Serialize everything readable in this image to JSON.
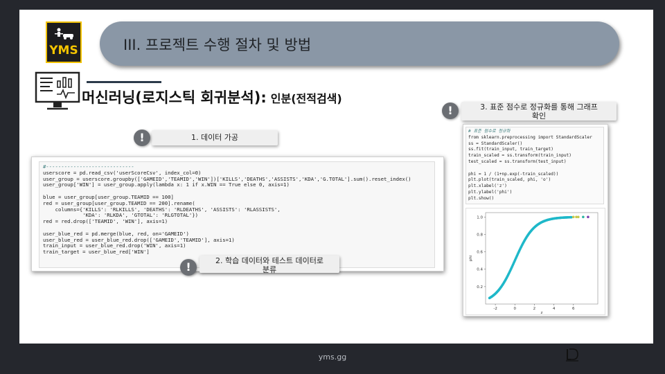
{
  "logo": {
    "text": "YMS"
  },
  "header": {
    "title": "III. 프로젝트 수행 절차 및 방법"
  },
  "headline": {
    "main": "머신러닝(로지스틱 회귀분석):",
    "sub": "인분(전적검색)"
  },
  "callouts": [
    {
      "label": "1. 데이터 가공"
    },
    {
      "label_line1": "2. 학습 데이터와 테스트 데이터로",
      "label_line2": "분류"
    },
    {
      "label_line1": "3. 표준 점수로 정규화를 통해 그래프",
      "label_line2": "확인"
    }
  ],
  "code_left": {
    "lines": [
      "#-----------------------------",
      "userscore = pd.read_csv('userScoreCsv', index_col=0)",
      "user_group = userscore.groupby(['GAMEID','TEAMID','WIN'])['KILLS','DEATHS','ASSISTS','KDA','G.TOTAL'].sum().reset_index()",
      "user_group['WIN'] = user_group.apply(lambda x: 1 if x.WIN == True else 0, axis=1)",
      "",
      "blue = user_group[user_group.TEAMID == 100]",
      "red = user_group[user_group.TEAMID == 200].rename(",
      "    columns={'KILLS': 'RLKILLS', 'DEATHS': 'RLDEATHS', 'ASSISTS': 'RLASSISTS',",
      "             'KDA': 'RLKDA', 'GTOTAL': 'RLGTOTAL'})",
      "red = red.drop(['TEAMID', 'WIN'], axis=1)",
      "",
      "user_blue_red = pd.merge(blue, red, on='GAMEID')",
      "user_blue_red = user_blue_red.drop(['GAMEID','TEAMID'], axis=1)",
      "train_input = user_blue_red.drop('WIN', axis=1)",
      "train_target = user_blue_red['WIN']"
    ]
  },
  "code_right": {
    "lines": [
      "# 표준 점수로 정규화",
      "from sklearn.preprocessing import StandardScaler",
      "ss = StandardScaler()",
      "ss.fit(train_input, train_target)",
      "train_scaled = ss.transform(train_input)",
      "test_scaled = ss.transform(test_input)",
      "",
      "phi = 1 / (1+np.exp(-train_scaled))",
      "plt.plot(train_scaled, phi, 'o')",
      "plt.xlabel('z')",
      "plt.ylabel('phi')",
      "plt.show()"
    ]
  },
  "chart_data": {
    "type": "scatter",
    "title": "",
    "xlabel": "z",
    "ylabel": "phi",
    "xlim": [
      -3,
      8.5
    ],
    "ylim": [
      0,
      1.05
    ],
    "xticks": [
      -2,
      0,
      2,
      4,
      6
    ],
    "yticks": [
      0.2,
      0.4,
      0.6,
      0.8,
      1.0
    ],
    "series": [
      {
        "color": "#1fb8c9",
        "curve": "sigmoid",
        "x_range": [
          -2.6,
          5.8
        ]
      },
      {
        "color": "#c6c84a",
        "x": [
          6.0,
          6.3,
          6.5
        ],
        "y": [
          1.0,
          1.0,
          1.0
        ]
      },
      {
        "color": "#2ab4a0",
        "x": [
          7.0
        ],
        "y": [
          1.0
        ]
      },
      {
        "color": "#7b3fb0",
        "x": [
          7.5
        ],
        "y": [
          1.0
        ]
      }
    ]
  },
  "footer": {
    "text": "yms.gg"
  },
  "colors": {
    "banner": "#8a97a6",
    "accent": "#f2c200",
    "curve": "#1fb8c9"
  }
}
